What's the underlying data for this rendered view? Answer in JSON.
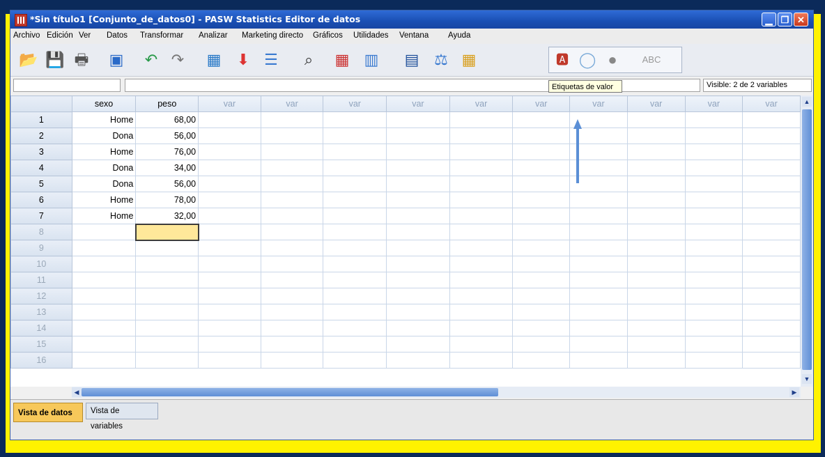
{
  "window": {
    "title": "*Sin título1 [Conjunto_de_datos0] - PASW Statistics Editor de datos"
  },
  "menu": [
    "Archivo",
    "Edición",
    "Ver",
    "Datos",
    "Transformar",
    "Analizar",
    "Marketing directo",
    "Gráficos",
    "Utilidades",
    "Ventana",
    "Ayuda"
  ],
  "toolbar": {
    "icons": [
      "open-icon",
      "save-icon",
      "print-icon",
      "recall-dialog-icon",
      "undo-icon",
      "redo-icon",
      "goto-case-icon",
      "goto-variable-icon",
      "variables-icon",
      "find-icon",
      "insert-cases-icon",
      "insert-variable-icon",
      "split-file-icon",
      "weight-cases-icon",
      "select-cases-icon",
      "value-labels-icon",
      "use-sets-icon",
      "show-all-variables-icon",
      "spell-check-icon"
    ],
    "tooltip": "Etiquetas de valor"
  },
  "status": {
    "visible": "Visible: 2 de 2 variables"
  },
  "grid": {
    "columns": [
      "sexo",
      "peso",
      "var",
      "var",
      "var",
      "var",
      "var",
      "var",
      "var",
      "var",
      "var",
      "var"
    ],
    "rows": [
      {
        "n": "1",
        "sexo": "Home",
        "peso": "68,00"
      },
      {
        "n": "2",
        "sexo": "Dona",
        "peso": "56,00"
      },
      {
        "n": "3",
        "sexo": "Home",
        "peso": "76,00"
      },
      {
        "n": "4",
        "sexo": "Dona",
        "peso": "34,00"
      },
      {
        "n": "5",
        "sexo": "Dona",
        "peso": "56,00"
      },
      {
        "n": "6",
        "sexo": "Home",
        "peso": "78,00"
      },
      {
        "n": "7",
        "sexo": "Home",
        "peso": "32,00"
      }
    ],
    "empty_rows": [
      "8",
      "9",
      "10",
      "11",
      "12",
      "13",
      "14",
      "15",
      "16"
    ]
  },
  "tabs": {
    "data_view": "Vista de datos",
    "variable_view": "Vista de variables"
  },
  "colors": {
    "frame": "#fff200",
    "annotation_arrow": "#5b8fd6"
  }
}
